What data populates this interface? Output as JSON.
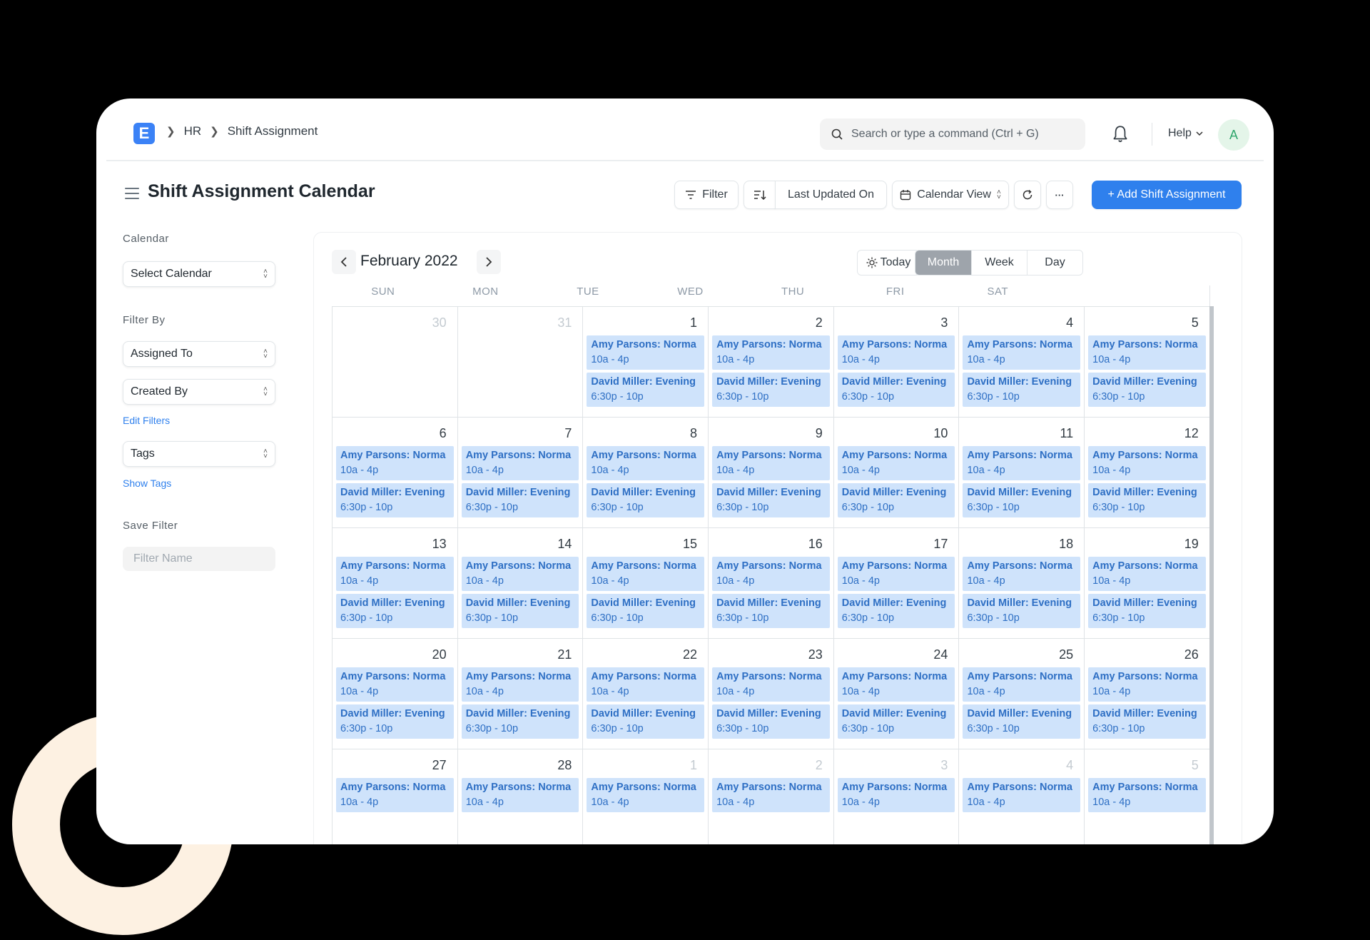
{
  "app": {
    "logo": "E"
  },
  "breadcrumb": {
    "items": [
      "HR",
      "Shift Assignment"
    ]
  },
  "search": {
    "placeholder": "Search or type a command (Ctrl + G)"
  },
  "help": {
    "label": "Help"
  },
  "avatar": {
    "initial": "A"
  },
  "page": {
    "title": "Shift Assignment Calendar"
  },
  "toolbar": {
    "filter_label": "Filter",
    "sort_label": "Last Updated On",
    "view_label": "Calendar View",
    "more_label": "···",
    "add_label": "+ Add Shift Assignment"
  },
  "sidebar": {
    "calendar_heading": "Calendar",
    "select_calendar": "Select Calendar",
    "filter_by_heading": "Filter By",
    "assigned_to": "Assigned To",
    "created_by": "Created By",
    "edit_filters": "Edit Filters",
    "tags": "Tags",
    "show_tags": "Show Tags",
    "save_filter_heading": "Save Filter",
    "filter_name_placeholder": "Filter Name"
  },
  "calendar": {
    "month_label": "February 2022",
    "today_label": "Today",
    "views": [
      "Month",
      "Week",
      "Day"
    ],
    "active_view": "Month",
    "weekdays": [
      "SUN",
      "MON",
      "TUE",
      "WED",
      "THU",
      "FRI",
      "SAT"
    ],
    "event_templates": {
      "amy": {
        "name": "Amy Parsons: Norma",
        "time": "10a - 4p"
      },
      "david": {
        "name": "David Miller: Evening",
        "time": "6:30p - 10p"
      }
    },
    "weeks": [
      [
        {
          "d": "30",
          "other": true,
          "ev": []
        },
        {
          "d": "31",
          "other": true,
          "ev": []
        },
        {
          "d": "1",
          "ev": [
            "amy",
            "david"
          ]
        },
        {
          "d": "2",
          "ev": [
            "amy",
            "david"
          ]
        },
        {
          "d": "3",
          "ev": [
            "amy",
            "david"
          ]
        },
        {
          "d": "4",
          "ev": [
            "amy",
            "david"
          ]
        },
        {
          "d": "5",
          "ev": [
            "amy",
            "david"
          ]
        }
      ],
      [
        {
          "d": "6",
          "ev": [
            "amy",
            "david"
          ]
        },
        {
          "d": "7",
          "ev": [
            "amy",
            "david"
          ]
        },
        {
          "d": "8",
          "ev": [
            "amy",
            "david"
          ]
        },
        {
          "d": "9",
          "ev": [
            "amy",
            "david"
          ]
        },
        {
          "d": "10",
          "ev": [
            "amy",
            "david"
          ]
        },
        {
          "d": "11",
          "ev": [
            "amy",
            "david"
          ]
        },
        {
          "d": "12",
          "ev": [
            "amy",
            "david"
          ]
        }
      ],
      [
        {
          "d": "13",
          "ev": [
            "amy",
            "david"
          ]
        },
        {
          "d": "14",
          "ev": [
            "amy",
            "david"
          ]
        },
        {
          "d": "15",
          "ev": [
            "amy",
            "david"
          ]
        },
        {
          "d": "16",
          "ev": [
            "amy",
            "david"
          ]
        },
        {
          "d": "17",
          "ev": [
            "amy",
            "david"
          ]
        },
        {
          "d": "18",
          "ev": [
            "amy",
            "david"
          ]
        },
        {
          "d": "19",
          "ev": [
            "amy",
            "david"
          ]
        }
      ],
      [
        {
          "d": "20",
          "ev": [
            "amy",
            "david"
          ]
        },
        {
          "d": "21",
          "ev": [
            "amy",
            "david"
          ]
        },
        {
          "d": "22",
          "ev": [
            "amy",
            "david"
          ]
        },
        {
          "d": "23",
          "ev": [
            "amy",
            "david"
          ]
        },
        {
          "d": "24",
          "ev": [
            "amy",
            "david"
          ]
        },
        {
          "d": "25",
          "ev": [
            "amy",
            "david"
          ]
        },
        {
          "d": "26",
          "ev": [
            "amy",
            "david"
          ]
        }
      ],
      [
        {
          "d": "27",
          "ev": [
            "amy"
          ]
        },
        {
          "d": "28",
          "ev": [
            "amy"
          ]
        },
        {
          "d": "1",
          "other": true,
          "ev": [
            "amy"
          ]
        },
        {
          "d": "2",
          "other": true,
          "ev": [
            "amy"
          ]
        },
        {
          "d": "3",
          "other": true,
          "ev": [
            "amy"
          ]
        },
        {
          "d": "4",
          "other": true,
          "ev": [
            "amy"
          ]
        },
        {
          "d": "5",
          "other": true,
          "ev": [
            "amy"
          ]
        }
      ]
    ]
  },
  "colors": {
    "primary": "#2f80ed",
    "event_bg": "#cfe3fb",
    "event_text": "#2e6fc4",
    "accent_ring": "#fdf1e2"
  }
}
